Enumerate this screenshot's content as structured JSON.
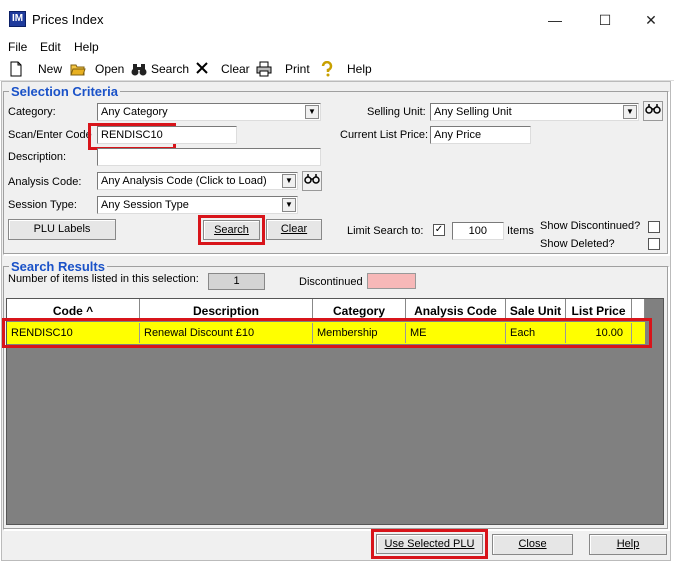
{
  "window": {
    "title": "Prices Index",
    "icon_text": "IM"
  },
  "menu": [
    "File",
    "Edit",
    "Help"
  ],
  "toolbar": {
    "new": "New",
    "open": "Open",
    "search": "Search",
    "clear": "Clear",
    "print": "Print",
    "help": "Help"
  },
  "criteria": {
    "title": "Selection Criteria",
    "category_label": "Category:",
    "category_value": "Any Category",
    "scan_label": "Scan/Enter Code",
    "scan_value": "RENDISC10",
    "description_label": "Description:",
    "description_value": "",
    "analysis_label": "Analysis Code:",
    "analysis_value": "Any Analysis Code (Click to Load)",
    "session_label": "Session Type:",
    "session_value": "Any Session Type",
    "plu_labels": "PLU Labels",
    "search_btn": "Search",
    "clear_btn": "Clear",
    "selling_unit_label": "Selling Unit:",
    "selling_unit_value": "Any Selling Unit",
    "list_price_label": "Current List Price:",
    "list_price_value": "Any Price",
    "limit_label": "Limit Search to:",
    "limit_checked": "✓",
    "limit_value": "100",
    "items_label": "Items",
    "show_discontinued": "Show Discontinued?",
    "show_deleted": "Show Deleted?"
  },
  "results": {
    "title": "Search Results",
    "count_label": "Number of items listed in this selection:",
    "count_value": "1",
    "discontinued_label": "Discontinued",
    "discontinued_color": "#f7b8b8",
    "columns": [
      "Code ^",
      "Description",
      "Category",
      "Analysis Code",
      "Sale Unit",
      "List Price"
    ],
    "rows": [
      [
        "RENDISC10",
        "Renewal Discount £10",
        "Membership",
        "ME",
        "Each",
        "10.00"
      ]
    ],
    "highlight_color": "#ffff00"
  },
  "footer": {
    "use_selected": "Use Selected PLU",
    "close": "Close",
    "help": "Help"
  },
  "colors": {
    "section_title": "#1a52c8",
    "annotation_red": "#d8141a"
  }
}
